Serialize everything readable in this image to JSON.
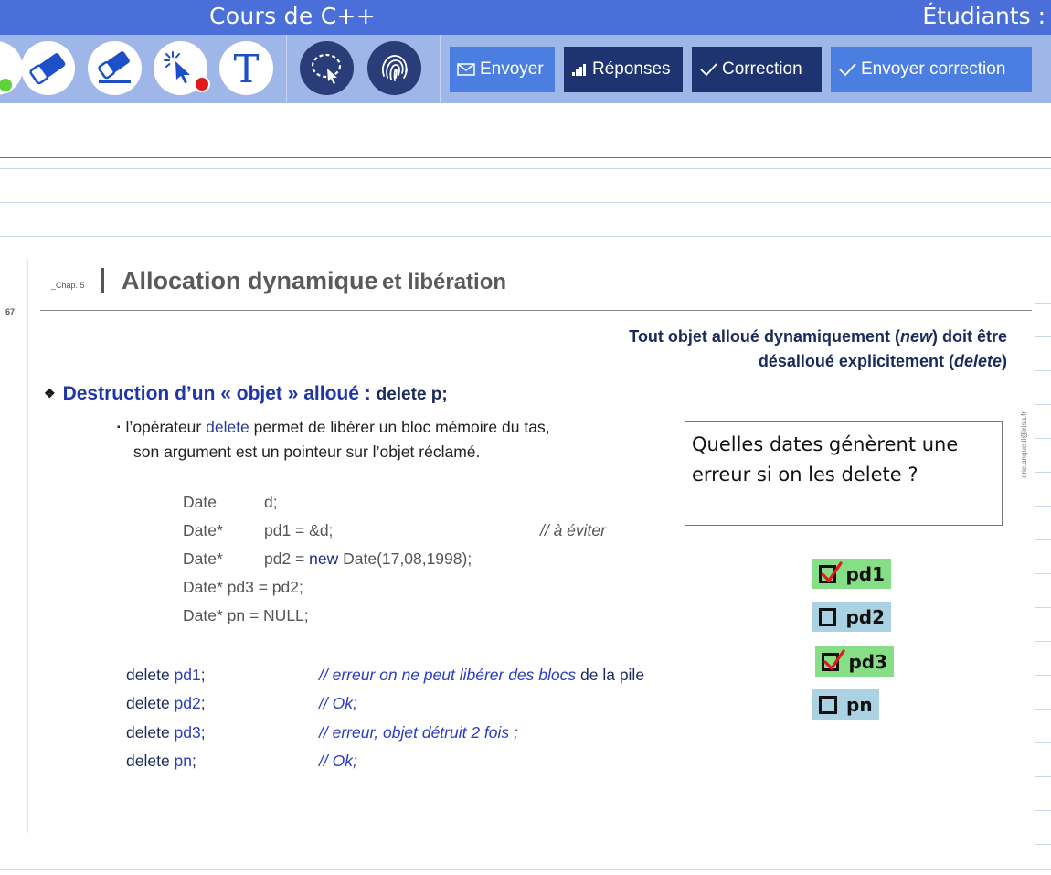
{
  "titlebar": {
    "title": "Cours de C++",
    "students": "Étudiants :"
  },
  "toolbar": {
    "tools": [
      {
        "name": "pen-icon",
        "indicator": "green"
      },
      {
        "name": "eraser-icon"
      },
      {
        "name": "eraser-line-icon"
      },
      {
        "name": "pointer-icon",
        "indicator": "red"
      },
      {
        "name": "text-icon",
        "glyph": "T"
      },
      {
        "name": "lasso-select-icon"
      },
      {
        "name": "fingerprint-icon"
      }
    ],
    "buttons": {
      "send": "Envoyer",
      "answers": "Réponses",
      "correction": "Correction",
      "send_correction": "Envoyer correction"
    },
    "colors": {
      "light_button": "#4a7ee0",
      "dark_button": "#1e3470",
      "toolbar_bg": "#9fb6e8",
      "titlebar_bg": "#4a6fd8"
    }
  },
  "slide": {
    "chap": "_Chap. 5",
    "title_main": "Allocation dynamique",
    "title_rest": "et libération",
    "page_number": "67",
    "note_line1_a": "Tout objet alloué dynamiquement (",
    "note_line1_em": "new",
    "note_line1_b": ") doit être",
    "note_line2_a": "désalloué explicitement (",
    "note_line2_em": "delete",
    "note_line2_b": ")",
    "bullet_diamond": "❖",
    "bullet_main": "Destruction d’un « objet » alloué :",
    "bullet_tail": "delete p;",
    "desc_sq": "▪",
    "desc_line1_a": "l’opérateur ",
    "desc_line1_kw": "delete",
    "desc_line1_b": " permet de libérer un bloc mémoire du tas,",
    "desc_line2": "son argument est un pointeur sur l’objet réclamé.",
    "code": {
      "l1_type": "Date",
      "l1_rest": "d;",
      "l2_type": "Date*",
      "l2_rest": "pd1 = &d;",
      "l2_comment": "// à éviter",
      "l3_type": "Date*",
      "l3_a": "pd2 = ",
      "l3_kw": "new",
      "l3_b": " Date(17,08,1998);",
      "l4": "Date* pd3 = pd2;",
      "l5": "Date* pn = NULL;"
    },
    "deletes": [
      {
        "kw": "delete ",
        "var": "pd1",
        "semi": ";",
        "comment": "// erreur on ne peut libérer des blocs",
        "comment_tail": " de la pile"
      },
      {
        "kw": "delete ",
        "var": "pd2",
        "semi": ";",
        "comment": "// Ok;",
        "comment_tail": ""
      },
      {
        "kw": "delete ",
        "var": "pd3",
        "semi": ";",
        "comment": "// erreur, objet détruit 2 fois ;",
        "comment_tail": ""
      },
      {
        "kw": "delete ",
        "var": "pn",
        "semi": ";",
        "comment": "// Ok;",
        "comment_tail": ""
      }
    ],
    "watermark": "eric.anquetil@irisa.fr"
  },
  "question": {
    "text": "Quelles dates génèrent une erreur si on les delete ?"
  },
  "answers": [
    {
      "label": "pd1",
      "checked": true
    },
    {
      "label": "pd2",
      "checked": false
    },
    {
      "label": "pd3",
      "checked": true
    },
    {
      "label": "pn",
      "checked": false
    }
  ]
}
